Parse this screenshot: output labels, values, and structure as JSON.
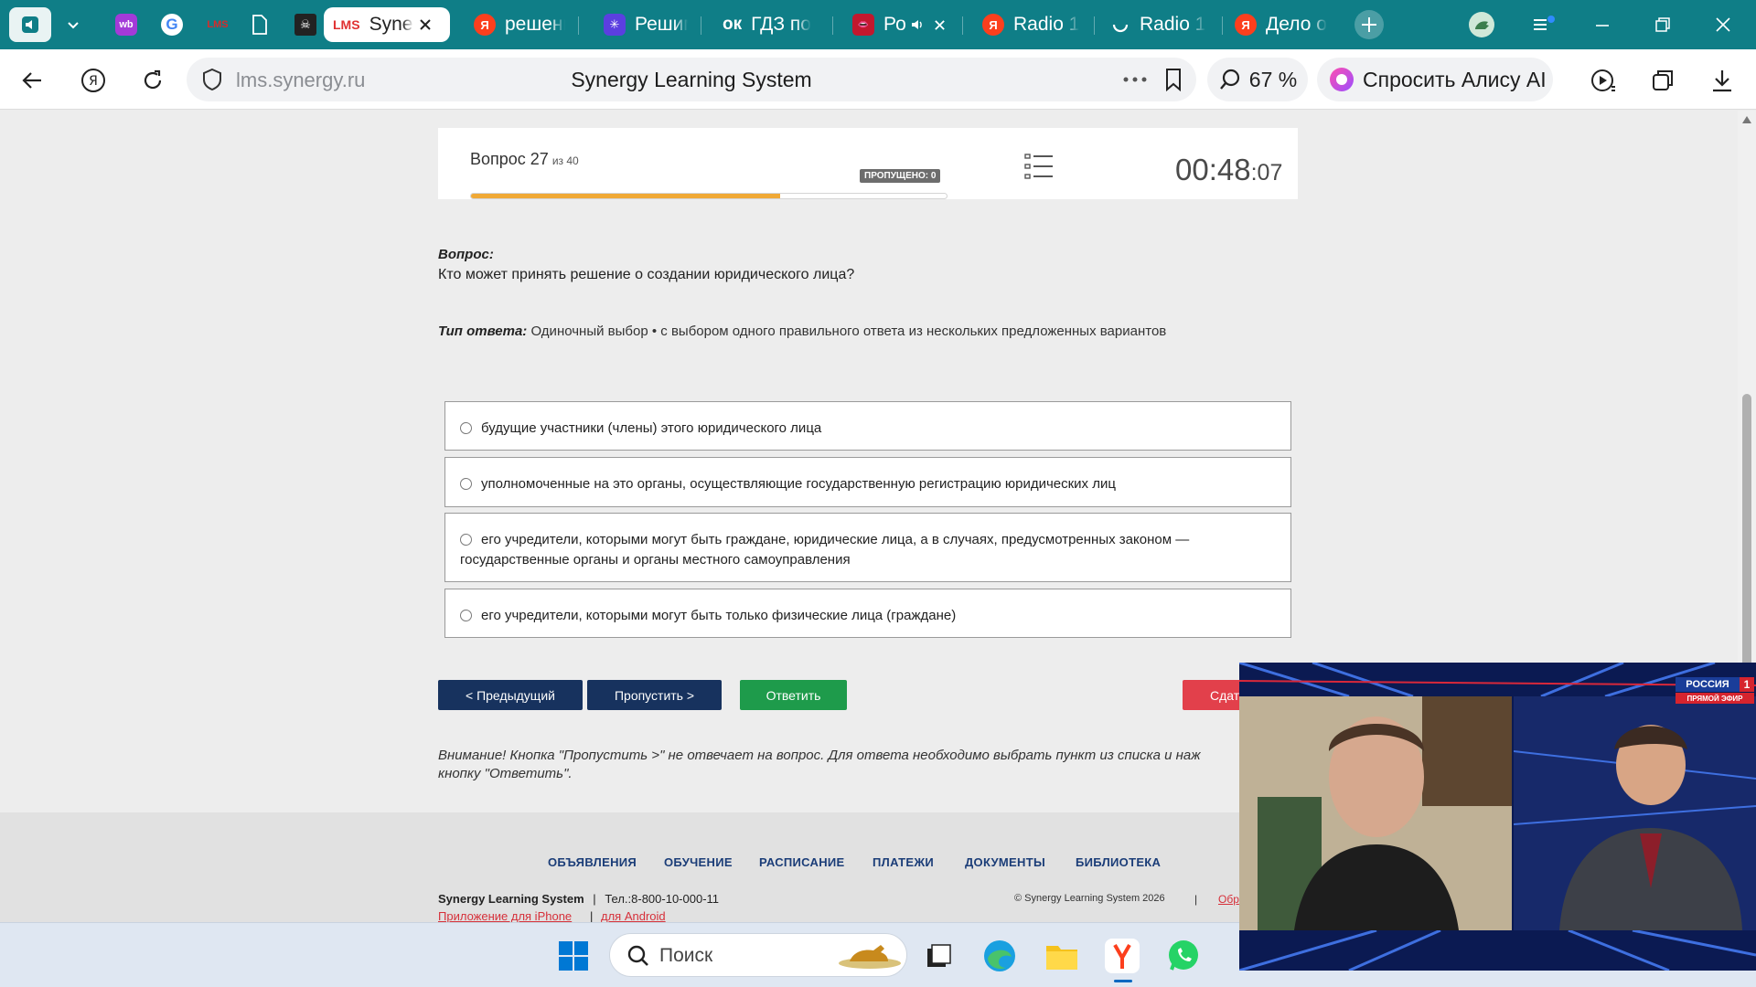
{
  "browser": {
    "tabs": [
      {
        "title": "",
        "fav_text": "wb",
        "fav_color": "#a33ad8"
      },
      {
        "title": "",
        "fav_text": "G",
        "fav_color": "#ffffff"
      },
      {
        "title": "",
        "fav_text": "LMS",
        "fav_color": "#c72a2a"
      },
      {
        "title": "",
        "fav_text": "",
        "fav_color": "#0f7e87"
      },
      {
        "title": "",
        "fav_text": "",
        "fav_color": "#333333"
      },
      {
        "title": "Syne",
        "fav_text": "LMS",
        "fav_color": "#e03131",
        "active": true
      },
      {
        "title": "решени",
        "fav_text": "Я",
        "fav_color": "#fc3f1d"
      },
      {
        "title": "Решим",
        "fav_text": "✳",
        "fav_color": "#5b3fe0"
      },
      {
        "title": "ГДЗ по",
        "fav_text": "ок",
        "fav_color": "#0f7e87"
      },
      {
        "title": "Ро",
        "fav_text": "",
        "fav_color": "#c2182e"
      },
      {
        "title": "Radio 1",
        "fav_text": "Я",
        "fav_color": "#fc3f1d"
      },
      {
        "title": "Radio 1",
        "fav_text": "",
        "fav_color": "#0f7e87"
      },
      {
        "title": "Дело о",
        "fav_text": "Я",
        "fav_color": "#fc3f1d"
      }
    ],
    "url": "lms.synergy.ru",
    "page_title": "Synergy Learning System",
    "zoom": "67 %",
    "alice_label": "Спросить Алису AI"
  },
  "quiz": {
    "question_label": "Вопрос 27",
    "question_of": "из 40",
    "progress": 0.65,
    "skipped_badge": "ПРОПУЩЕНО: 0",
    "timer_main": "00:48",
    "timer_sec": ":07",
    "q_heading": "Вопрос:",
    "q_text": "Кто может принять решение о создании юридического лица?",
    "type_label": "Тип ответа:",
    "type_text": "Одиночный выбор • с выбором одного правильного ответа из нескольких предложенных вариантов",
    "answers": [
      "будущие участники (члены) этого юридического лица",
      "уполномоченные на это органы, осуществляющие государственную регистрацию юридических лиц",
      "его учредители, которыми могут быть граждане, юридические лица, а в случаях, предусмотренных законом — государственные органы и органы местного самоуправления",
      "его учредители, которыми могут быть только физические лица (граждане)"
    ],
    "btn_prev": "< Предыдущий",
    "btn_skip": "Пропустить >",
    "btn_answer": "Ответить",
    "btn_finish": "Сдат",
    "warning": "Внимание! Кнопка \"Пропустить >\" не отвечает на вопрос. Для ответа необходимо выбрать пункт из списка и наж кнопку \"Ответить\"."
  },
  "footer": {
    "nav": [
      "ОБЪЯВЛЕНИЯ",
      "ОБУЧЕНИЕ",
      "РАСПИСАНИЕ",
      "ПЛАТЕЖИ",
      "ДОКУМЕНТЫ",
      "БИБЛИОТЕКА"
    ],
    "brand": "Synergy Learning System",
    "phone": "Тел.:8-800-10-000-11",
    "link_iphone": "Приложение для iPhone",
    "link_android": "для Android",
    "copyright": "© Synergy Learning System 2026",
    "copy_sep": "|",
    "link_cut": "Обр"
  },
  "taskbar": {
    "search_placeholder": "Поиск"
  },
  "video": {
    "channel": "РОССИЯ",
    "channel_num": "1",
    "live": "ПРЯМОЙ ЭФИР"
  },
  "colors": {
    "tab_strip": "#0f7e87",
    "nav_button": "#17325e",
    "answer_button": "#1e9b4b",
    "finish_button": "#e2404b",
    "progress": "#f0a936"
  }
}
